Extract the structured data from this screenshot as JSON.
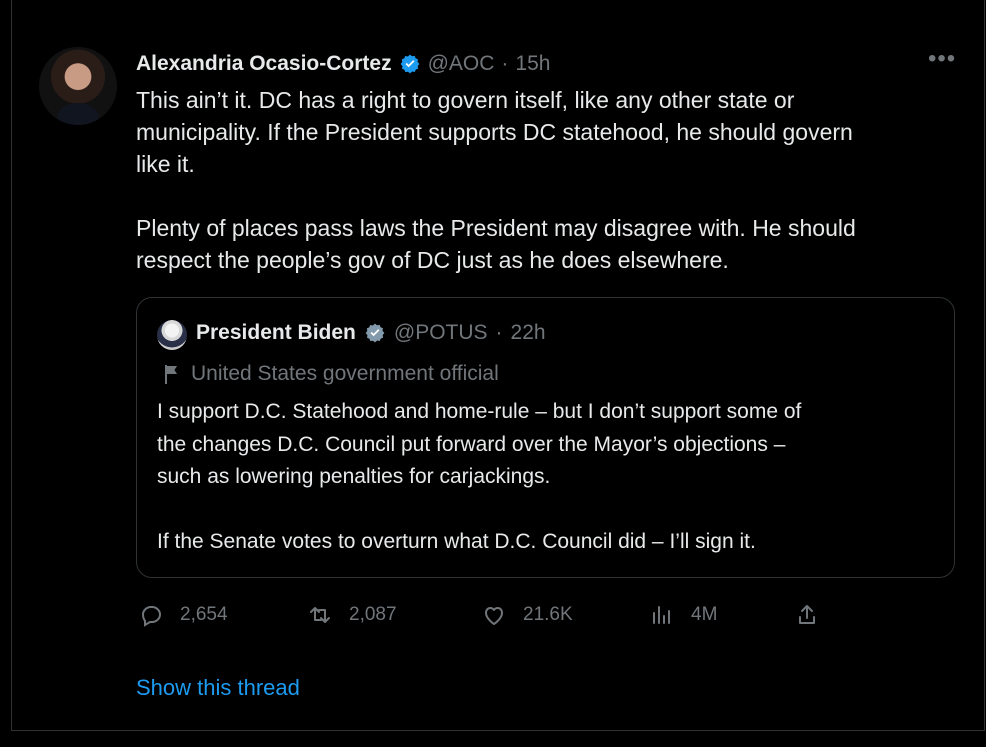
{
  "tweet": {
    "author_name": "Alexandria Ocasio-Cortez",
    "handle": "@AOC",
    "separator": "·",
    "time": "15h",
    "text": "This ain’t it. DC has a right to govern itself, like any other state or\nmunicipality. If the President supports DC statehood, he should govern\nlike it.\n\nPlenty of places pass laws the President may disagree with. He should\nrespect the people’s gov of DC just as he does elsewhere.",
    "more_label": "•••"
  },
  "quote": {
    "author_name": "President Biden",
    "handle": "@POTUS",
    "separator": "·",
    "time": "22h",
    "government_label": "United States government official",
    "text": "I support D.C. Statehood and home-rule – but I don’t support some of\nthe changes D.C. Council put forward over the Mayor’s objections –\nsuch as lowering penalties for carjackings.\n\nIf the Senate votes to overturn what D.C. Council did – I’ll sign it."
  },
  "actions": {
    "reply_count": "2,654",
    "retweet_count": "2,087",
    "like_count": "21.6K",
    "view_count": "4M"
  },
  "thread_link": "Show this thread",
  "icons": {
    "verified": "verified-badge-icon",
    "reply": "reply-icon",
    "retweet": "retweet-icon",
    "like": "heart-icon",
    "views": "analytics-icon",
    "share": "share-icon"
  },
  "colors": {
    "background": "#000000",
    "primary_text": "#e7e9ea",
    "secondary_text": "#71767b",
    "accent": "#1d9bf0",
    "border": "#2f3336",
    "verified_aoc": "#1d9bf0",
    "verified_potus": "#829aab"
  }
}
